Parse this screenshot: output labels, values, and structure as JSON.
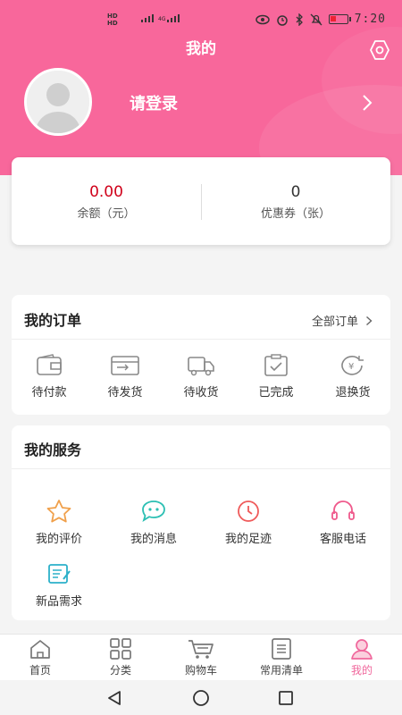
{
  "status_bar": {
    "time": "7:20",
    "network_1": "HD",
    "network_2": "HD",
    "signal_label": "4G"
  },
  "header": {
    "title": "我的",
    "login_prompt": "请登录"
  },
  "balance": {
    "items": [
      {
        "value": "0.00",
        "label": "余额（元）",
        "color": "#d0021b"
      },
      {
        "value": "0",
        "label": "优惠券（张）",
        "color": "#333333"
      }
    ]
  },
  "orders": {
    "title": "我的订单",
    "all_label": "全部订单",
    "items": [
      {
        "label": "待付款",
        "icon": "wallet-icon"
      },
      {
        "label": "待发货",
        "icon": "card-send-icon"
      },
      {
        "label": "待收货",
        "icon": "truck-icon"
      },
      {
        "label": "已完成",
        "icon": "clipboard-check-icon"
      },
      {
        "label": "退换货",
        "icon": "refund-icon"
      }
    ]
  },
  "services": {
    "title": "我的服务",
    "items": [
      {
        "label": "我的评价",
        "icon": "star-icon",
        "color": "#f0a04b"
      },
      {
        "label": "我的消息",
        "icon": "chat-icon",
        "color": "#2bbfb3"
      },
      {
        "label": "我的足迹",
        "icon": "clock-icon",
        "color": "#ef5a5a"
      },
      {
        "label": "客服电话",
        "icon": "headset-icon",
        "color": "#ef5a8c"
      },
      {
        "label": "新品需求",
        "icon": "edit-note-icon",
        "color": "#2bb0c9"
      }
    ]
  },
  "tabbar": {
    "active_color": "#f0679c",
    "items": [
      {
        "label": "首页",
        "icon": "home-icon"
      },
      {
        "label": "分类",
        "icon": "grid-icon"
      },
      {
        "label": "购物车",
        "icon": "cart-icon"
      },
      {
        "label": "常用清单",
        "icon": "list-icon"
      },
      {
        "label": "我的",
        "icon": "user-icon",
        "active": true
      }
    ]
  },
  "theme": {
    "brand": "#f8679b"
  }
}
